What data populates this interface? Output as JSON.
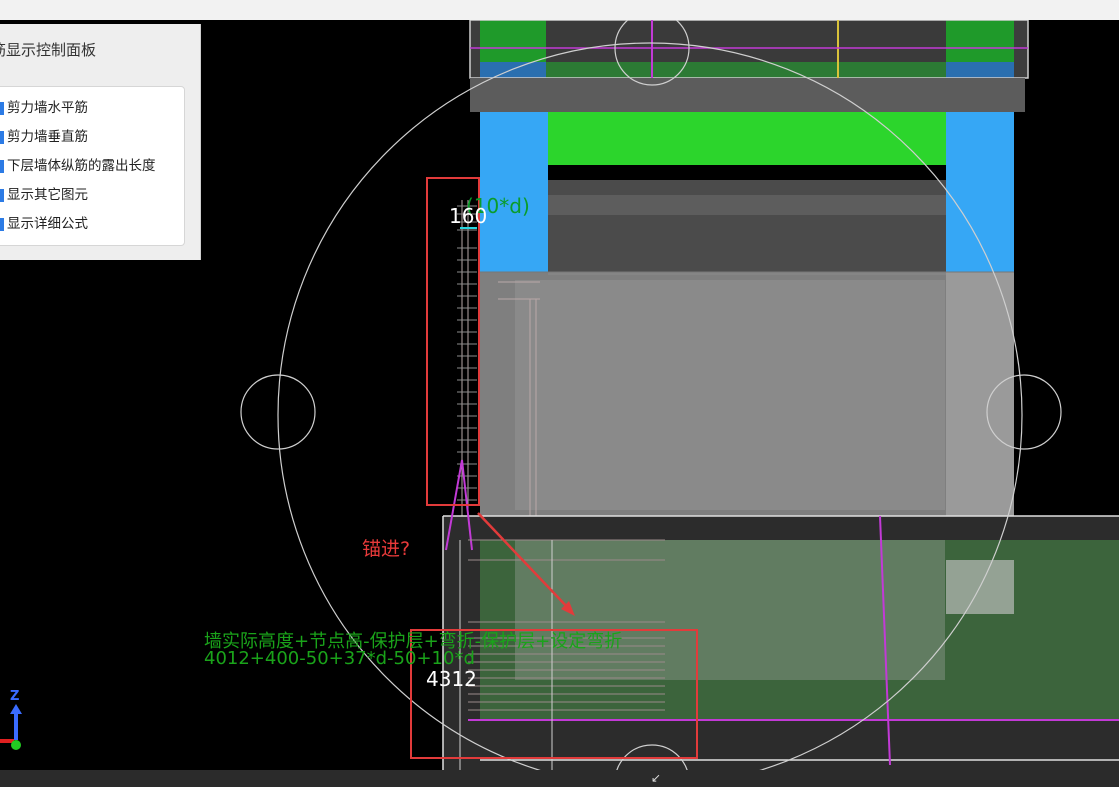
{
  "panel": {
    "title": "筋显示控制面板",
    "options": [
      {
        "label": "剪力墙水平筋"
      },
      {
        "label": "剪力墙垂直筋"
      },
      {
        "label": "下层墙体纵筋的露出长度"
      },
      {
        "label": "显示其它图元"
      },
      {
        "label": "显示详细公式"
      }
    ]
  },
  "annotations": {
    "dim_top": "160",
    "expr_top": "(10*d)",
    "anchor_question": "锚进?",
    "formula_text": "墙实际高度+节点高-保护层+弯折-保护层+设定弯折",
    "formula_values": "4012+400-50+37*d-50+10*d",
    "dim_bottom": "4312"
  },
  "axis": {
    "label": "Z"
  },
  "colors": {
    "green_rebar": "#2cd52c",
    "blue_column": "#36a7f5",
    "gray_wall": "#8a8a8a",
    "magenta_line": "#c23ad6",
    "red_box": "#e23b3b",
    "formula_green": "#1aa31a"
  },
  "icons": [
    "axis-gizmo-icon",
    "resize-arrow-icon"
  ]
}
